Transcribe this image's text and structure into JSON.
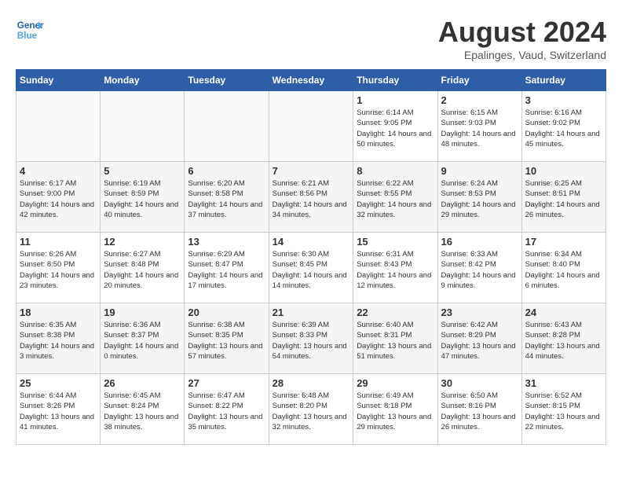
{
  "header": {
    "logo_line1": "General",
    "logo_line2": "Blue",
    "month": "August 2024",
    "location": "Epalinges, Vaud, Switzerland"
  },
  "days_of_week": [
    "Sunday",
    "Monday",
    "Tuesday",
    "Wednesday",
    "Thursday",
    "Friday",
    "Saturday"
  ],
  "weeks": [
    [
      {
        "day": "",
        "empty": true
      },
      {
        "day": "",
        "empty": true
      },
      {
        "day": "",
        "empty": true
      },
      {
        "day": "",
        "empty": true
      },
      {
        "day": "1",
        "sunrise": "6:14 AM",
        "sunset": "9:05 PM",
        "daylight": "14 hours and 50 minutes."
      },
      {
        "day": "2",
        "sunrise": "6:15 AM",
        "sunset": "9:03 PM",
        "daylight": "14 hours and 48 minutes."
      },
      {
        "day": "3",
        "sunrise": "6:16 AM",
        "sunset": "9:02 PM",
        "daylight": "14 hours and 45 minutes."
      }
    ],
    [
      {
        "day": "4",
        "sunrise": "6:17 AM",
        "sunset": "9:00 PM",
        "daylight": "14 hours and 42 minutes."
      },
      {
        "day": "5",
        "sunrise": "6:19 AM",
        "sunset": "8:59 PM",
        "daylight": "14 hours and 40 minutes."
      },
      {
        "day": "6",
        "sunrise": "6:20 AM",
        "sunset": "8:58 PM",
        "daylight": "14 hours and 37 minutes."
      },
      {
        "day": "7",
        "sunrise": "6:21 AM",
        "sunset": "8:56 PM",
        "daylight": "14 hours and 34 minutes."
      },
      {
        "day": "8",
        "sunrise": "6:22 AM",
        "sunset": "8:55 PM",
        "daylight": "14 hours and 32 minutes."
      },
      {
        "day": "9",
        "sunrise": "6:24 AM",
        "sunset": "8:53 PM",
        "daylight": "14 hours and 29 minutes."
      },
      {
        "day": "10",
        "sunrise": "6:25 AM",
        "sunset": "8:51 PM",
        "daylight": "14 hours and 26 minutes."
      }
    ],
    [
      {
        "day": "11",
        "sunrise": "6:26 AM",
        "sunset": "8:50 PM",
        "daylight": "14 hours and 23 minutes."
      },
      {
        "day": "12",
        "sunrise": "6:27 AM",
        "sunset": "8:48 PM",
        "daylight": "14 hours and 20 minutes."
      },
      {
        "day": "13",
        "sunrise": "6:29 AM",
        "sunset": "8:47 PM",
        "daylight": "14 hours and 17 minutes."
      },
      {
        "day": "14",
        "sunrise": "6:30 AM",
        "sunset": "8:45 PM",
        "daylight": "14 hours and 14 minutes."
      },
      {
        "day": "15",
        "sunrise": "6:31 AM",
        "sunset": "8:43 PM",
        "daylight": "14 hours and 12 minutes."
      },
      {
        "day": "16",
        "sunrise": "6:33 AM",
        "sunset": "8:42 PM",
        "daylight": "14 hours and 9 minutes."
      },
      {
        "day": "17",
        "sunrise": "6:34 AM",
        "sunset": "8:40 PM",
        "daylight": "14 hours and 6 minutes."
      }
    ],
    [
      {
        "day": "18",
        "sunrise": "6:35 AM",
        "sunset": "8:38 PM",
        "daylight": "14 hours and 3 minutes."
      },
      {
        "day": "19",
        "sunrise": "6:36 AM",
        "sunset": "8:37 PM",
        "daylight": "14 hours and 0 minutes."
      },
      {
        "day": "20",
        "sunrise": "6:38 AM",
        "sunset": "8:35 PM",
        "daylight": "13 hours and 57 minutes."
      },
      {
        "day": "21",
        "sunrise": "6:39 AM",
        "sunset": "8:33 PM",
        "daylight": "13 hours and 54 minutes."
      },
      {
        "day": "22",
        "sunrise": "6:40 AM",
        "sunset": "8:31 PM",
        "daylight": "13 hours and 51 minutes."
      },
      {
        "day": "23",
        "sunrise": "6:42 AM",
        "sunset": "8:29 PM",
        "daylight": "13 hours and 47 minutes."
      },
      {
        "day": "24",
        "sunrise": "6:43 AM",
        "sunset": "8:28 PM",
        "daylight": "13 hours and 44 minutes."
      }
    ],
    [
      {
        "day": "25",
        "sunrise": "6:44 AM",
        "sunset": "8:26 PM",
        "daylight": "13 hours and 41 minutes."
      },
      {
        "day": "26",
        "sunrise": "6:45 AM",
        "sunset": "8:24 PM",
        "daylight": "13 hours and 38 minutes."
      },
      {
        "day": "27",
        "sunrise": "6:47 AM",
        "sunset": "8:22 PM",
        "daylight": "13 hours and 35 minutes."
      },
      {
        "day": "28",
        "sunrise": "6:48 AM",
        "sunset": "8:20 PM",
        "daylight": "13 hours and 32 minutes."
      },
      {
        "day": "29",
        "sunrise": "6:49 AM",
        "sunset": "8:18 PM",
        "daylight": "13 hours and 29 minutes."
      },
      {
        "day": "30",
        "sunrise": "6:50 AM",
        "sunset": "8:16 PM",
        "daylight": "13 hours and 26 minutes."
      },
      {
        "day": "31",
        "sunrise": "6:52 AM",
        "sunset": "8:15 PM",
        "daylight": "13 hours and 22 minutes."
      }
    ]
  ]
}
